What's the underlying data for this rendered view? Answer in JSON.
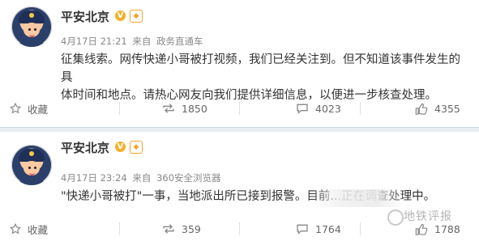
{
  "post1": {
    "username": "平安北京",
    "verified_icon": "verified-v-icon",
    "org_icon": "org-badge-icon",
    "timestamp": "4月17日 21:21",
    "source_prefix": "来自",
    "source": "政务直通车",
    "text_line1": "征集线索。网传快递小哥被打视频，我们已经关注到。但不知道该事件发生的具",
    "text_line2": "体时间和地点。请热心网友向我们提供详细信息，以便进一步核查处理。",
    "favorite_label": "收藏",
    "repost_count": "1850",
    "comment_count": "4023",
    "like_count": "4355"
  },
  "post2": {
    "username": "平安北京",
    "verified_icon": "verified-v-icon",
    "org_icon": "org-badge-icon",
    "timestamp": "4月17日 23:24",
    "source_prefix": "来自",
    "source": "360安全浏览器",
    "text": "\"快递小哥被打\"一事，当地派出所已接到报警。目前...正在调查处理中。",
    "favorite_label": "收藏",
    "repost_count": "359",
    "comment_count": "1764",
    "like_count": "1788"
  },
  "watermark": "地铁评报",
  "colors": {
    "divider": "#e9eef3",
    "divider_border": "#c8d9e6",
    "verified": "#f3b12b",
    "text": "#333333",
    "meta": "#888888"
  }
}
